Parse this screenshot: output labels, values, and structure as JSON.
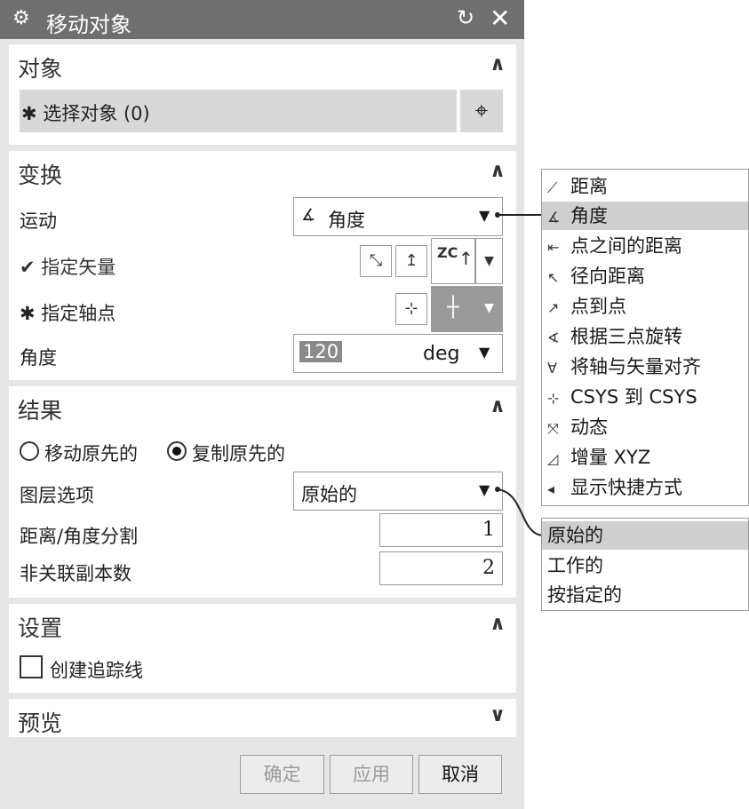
{
  "dialog": {
    "title": "移动对象",
    "title_icons": {
      "settings": "gear-icon",
      "reset": "reset-icon",
      "close": "close-icon"
    }
  },
  "object_section": {
    "title": "对象",
    "select_label": "✱ 选择对象 (0)",
    "crosshair_icon": "crosshair-icon"
  },
  "transform_section": {
    "title": "变换",
    "motion_label": "运动",
    "motion_value": "角度",
    "vector_label": "✔ 指定矢量",
    "vector_zc": "ZC",
    "pivot_label": "✱ 指定轴点",
    "angle_label": "角度",
    "angle_value": "120",
    "angle_unit": "deg"
  },
  "result_section": {
    "title": "结果",
    "radio_move": "移动原先的",
    "radio_copy": "复制原先的",
    "selected_radio": "复制原先的",
    "layer_label": "图层选项",
    "layer_value": "原始的",
    "distance_label": "距离/角度分割",
    "distance_value": "1",
    "copies_label": "非关联副本数",
    "copies_value": "2"
  },
  "settings_section": {
    "title": "设置",
    "trace_label": "创建追踪线",
    "trace_checked": false
  },
  "preview_section": {
    "title": "预览"
  },
  "buttons": {
    "ok": "确定",
    "apply": "应用",
    "cancel": "取消"
  },
  "motion_menu": {
    "items": [
      {
        "label": "距离",
        "icon": "distance-icon"
      },
      {
        "label": "角度",
        "icon": "angle-icon"
      },
      {
        "label": "点之间的距离",
        "icon": "point-distance-icon"
      },
      {
        "label": "径向距离",
        "icon": "radial-distance-icon"
      },
      {
        "label": "点到点",
        "icon": "point-to-point-icon"
      },
      {
        "label": "根据三点旋转",
        "icon": "three-point-rotate-icon"
      },
      {
        "label": "将轴与矢量对齐",
        "icon": "axis-align-icon"
      },
      {
        "label": "CSYS 到 CSYS",
        "icon": "csys-icon"
      },
      {
        "label": "动态",
        "icon": "dynamic-icon"
      },
      {
        "label": "增量 XYZ",
        "icon": "delta-xyz-icon"
      },
      {
        "label": "显示快捷方式",
        "icon": "shortcut-icon"
      }
    ],
    "selected": "角度"
  },
  "layer_menu": {
    "items": [
      {
        "label": "原始的"
      },
      {
        "label": "工作的"
      },
      {
        "label": "按指定的"
      }
    ],
    "selected": "原始的"
  },
  "colors": {
    "title_bar": "#6f6f6f",
    "panel": "#e6e6e6",
    "highlight": "#cfcfcf"
  }
}
